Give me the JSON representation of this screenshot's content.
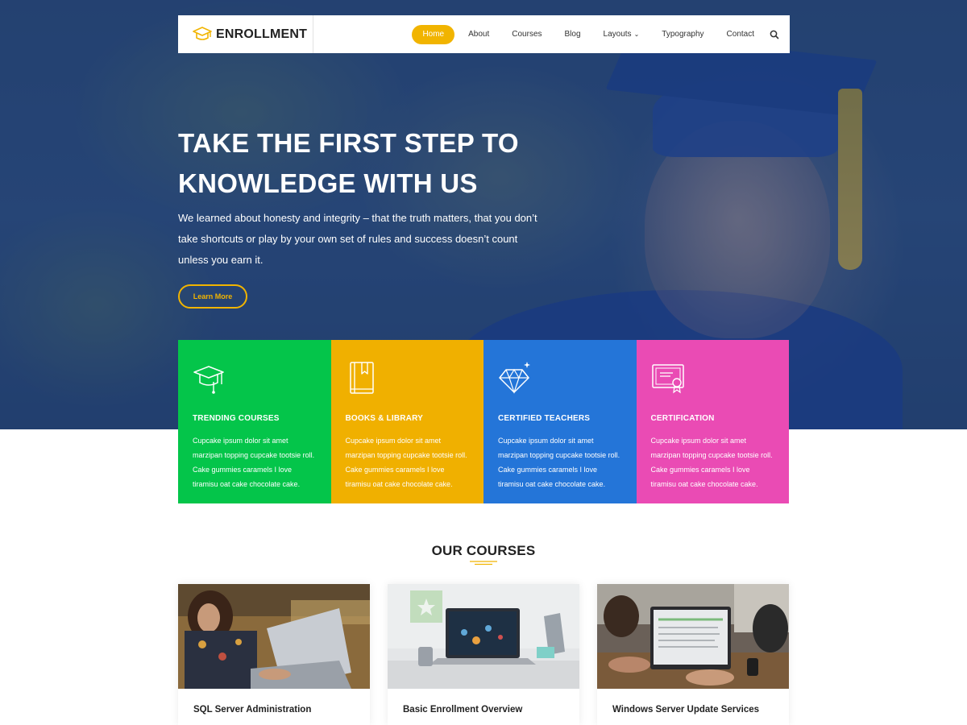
{
  "brand": {
    "name": "ENROLLMENT"
  },
  "nav": {
    "items": [
      "Home",
      "About",
      "Courses",
      "Blog",
      "Layouts",
      "Typography",
      "Contact"
    ],
    "active": "Home"
  },
  "hero": {
    "title_line1": "TAKE THE FIRST STEP TO",
    "title_line2": "KNOWLEDGE WITH US",
    "text_line1": "We learned about honesty and integrity – that the truth matters, that you don’t",
    "text_line2": "take shortcuts or play by your own set of rules and success doesn’t count",
    "text_line3": "unless you earn it.",
    "button": "Learn More"
  },
  "features": [
    {
      "title": "TRENDING COURSES",
      "color": "#04c54a",
      "icon": "graduation-cap-icon",
      "lines": [
        "Cupcake ipsum dolor sit amet",
        "marzipan topping cupcake tootsie roll.",
        "Cake gummies caramels I love",
        "tiramisu oat cake chocolate cake."
      ]
    },
    {
      "title": "BOOKS & LIBRARY",
      "color": "#f0b000",
      "icon": "book-icon",
      "lines": [
        "Cupcake ipsum dolor sit amet",
        "marzipan topping cupcake tootsie roll.",
        "Cake gummies caramels I love",
        "tiramisu oat cake chocolate cake."
      ]
    },
    {
      "title": "CERTIFIED TEACHERS",
      "color": "#2475d8",
      "icon": "diamond-icon",
      "lines": [
        "Cupcake ipsum dolor sit amet",
        "marzipan topping cupcake tootsie roll.",
        "Cake gummies caramels I love",
        "tiramisu oat cake chocolate cake."
      ]
    },
    {
      "title": "CERTIFICATION",
      "color": "#ea4bb4",
      "icon": "certificate-icon",
      "lines": [
        "Cupcake ipsum dolor sit amet",
        "marzipan topping cupcake tootsie roll.",
        "Cake gummies caramels I love",
        "tiramisu oat cake chocolate cake."
      ]
    }
  ],
  "courses": {
    "title": "OUR COURSES",
    "items": [
      {
        "name": "SQL Server Administration"
      },
      {
        "name": "Basic Enrollment Overview"
      },
      {
        "name": "Windows Server Update Services"
      }
    ]
  },
  "colors": {
    "accent": "#f1b400",
    "hero_overlay": "#1a386e"
  }
}
